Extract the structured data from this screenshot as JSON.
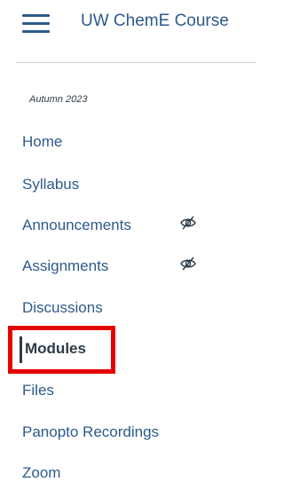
{
  "header": {
    "menu_icon": "hamburger-icon",
    "course_title": "UW ChemE Course"
  },
  "term": "Autumn 2023",
  "nav": {
    "items": [
      {
        "label": "Home"
      },
      {
        "label": "Syllabus"
      },
      {
        "label": "Announcements",
        "hidden_icon": "eye-slash-icon"
      },
      {
        "label": "Assignments",
        "hidden_icon": "eye-slash-icon"
      },
      {
        "label": "Discussions"
      },
      {
        "label": "Modules",
        "active": true
      },
      {
        "label": "Files"
      },
      {
        "label": "Panopto Recordings"
      },
      {
        "label": "Zoom"
      }
    ]
  },
  "colors": {
    "link": "#2d5a8c",
    "text": "#2d3b45",
    "highlight": "#e60000",
    "divider": "#c7cdd1"
  }
}
